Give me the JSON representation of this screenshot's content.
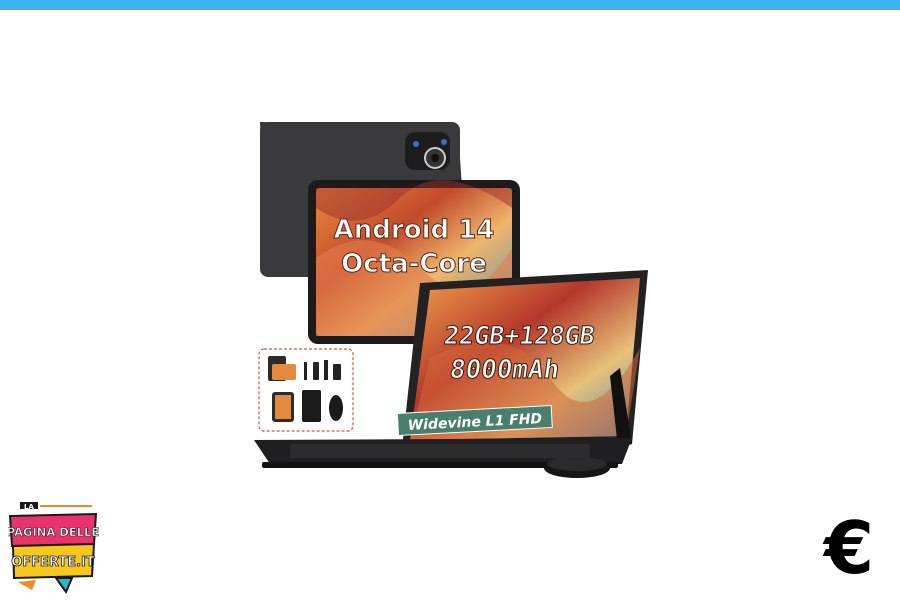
{
  "header": {
    "accent_color": "#3cb4ef"
  },
  "product": {
    "image_name": "android-tablet-with-keyboard",
    "texts": {
      "line1": "Android 14",
      "line2": "Octa-Core",
      "line3": "22GB+128GB",
      "line4": "8000mAh",
      "badge": "Widevine L1 FHD"
    }
  },
  "logo": {
    "word1": "LA",
    "word2": "PAGINA DELLE",
    "word3": "OFFERTE.IT",
    "colors": {
      "pink": "#e8336d",
      "yellow": "#f6c81e",
      "teal": "#2ab7c6"
    }
  },
  "currency": {
    "symbol": "€"
  }
}
